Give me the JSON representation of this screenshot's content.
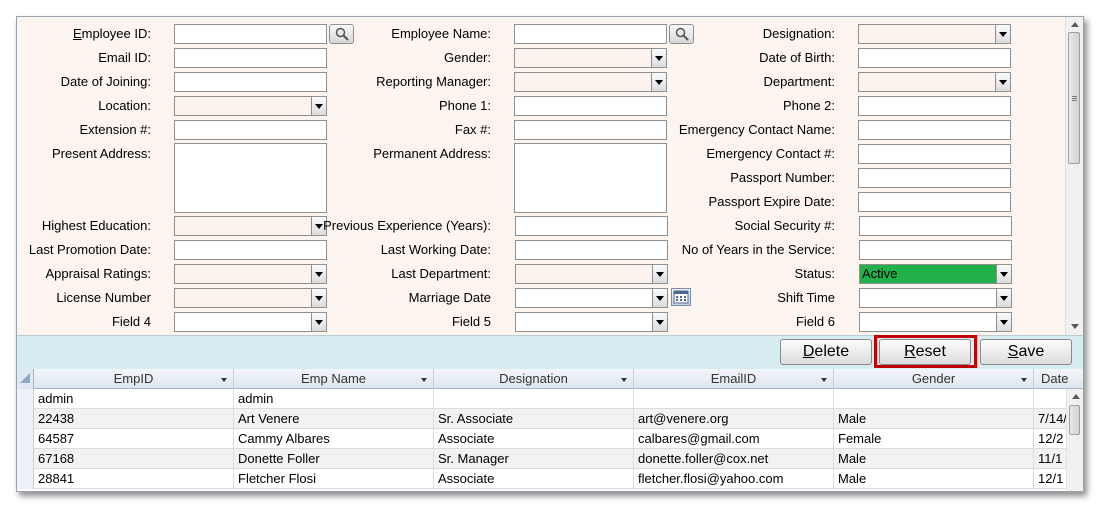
{
  "form": {
    "employee_id_label": "mployee ID:",
    "employee_id_accesskey": "E",
    "employee_name_label": "Employee Name:",
    "designation_label": "Designation:",
    "email_id_label": "Email ID:",
    "gender_label": "Gender:",
    "dob_label": "Date of Birth:",
    "doj_label": "Date of Joining:",
    "reporting_manager_label": "Reporting Manager:",
    "department_label": "Department:",
    "location_label": "Location:",
    "phone1_label": "Phone 1:",
    "phone2_label": "Phone 2:",
    "extension_label": "Extension #:",
    "fax_label": "Fax #:",
    "emergency_name_label": "Emergency Contact Name:",
    "present_address_label": "Present Address:",
    "permanent_address_label": "Permanent Address:",
    "emergency_number_label": "Emergency Contact #:",
    "passport_number_label": "Passport Number:",
    "passport_expire_label": "Passport Expire Date:",
    "highest_education_label": "Highest Education:",
    "previous_experience_label": "Previous Experience (Years):",
    "social_security_label": "Social Security #:",
    "last_promotion_label": "Last Promotion Date:",
    "last_working_label": "Last Working Date:",
    "years_service_label": "No of Years in the Service:",
    "appraisal_label": "Appraisal Ratings:",
    "last_department_label": "Last Department:",
    "status_label": "Status:",
    "status_value": "Active",
    "license_label": "License Number",
    "marriage_label": "Marriage Date",
    "shift_label": "Shift Time",
    "field4_label": "Field 4",
    "field5_label": "Field 5",
    "field6_label": "Field 6"
  },
  "buttons": {
    "delete": {
      "key": "D",
      "rest": "elete"
    },
    "reset": {
      "key": "R",
      "rest": "eset"
    },
    "save": {
      "key": "S",
      "rest": "ave"
    }
  },
  "grid": {
    "columns": [
      "EmpID",
      "Emp Name",
      "Designation",
      "EmailID",
      "Gender",
      "Date"
    ],
    "rows": [
      [
        "admin",
        "admin",
        "",
        "",
        "",
        ""
      ],
      [
        "22438",
        "Art Venere",
        "Sr. Associate",
        "art@venere.org",
        "Male",
        "7/14/"
      ],
      [
        "64587",
        "Cammy Albares",
        "Associate",
        "calbares@gmail.com",
        "Female",
        "12/2"
      ],
      [
        "67168",
        "Donette Foller",
        "Sr. Manager",
        "donette.foller@cox.net",
        "Male",
        "11/1"
      ],
      [
        "28841",
        "Fletcher Flosi",
        "Associate",
        "fletcher.flosi@yahoo.com",
        "Male",
        "12/1"
      ]
    ]
  },
  "colors": {
    "form_bg": "#fcf4ef",
    "button_bar_bg": "#d6ecf1",
    "status_active": "#22b04b",
    "highlight": "#c00000"
  }
}
